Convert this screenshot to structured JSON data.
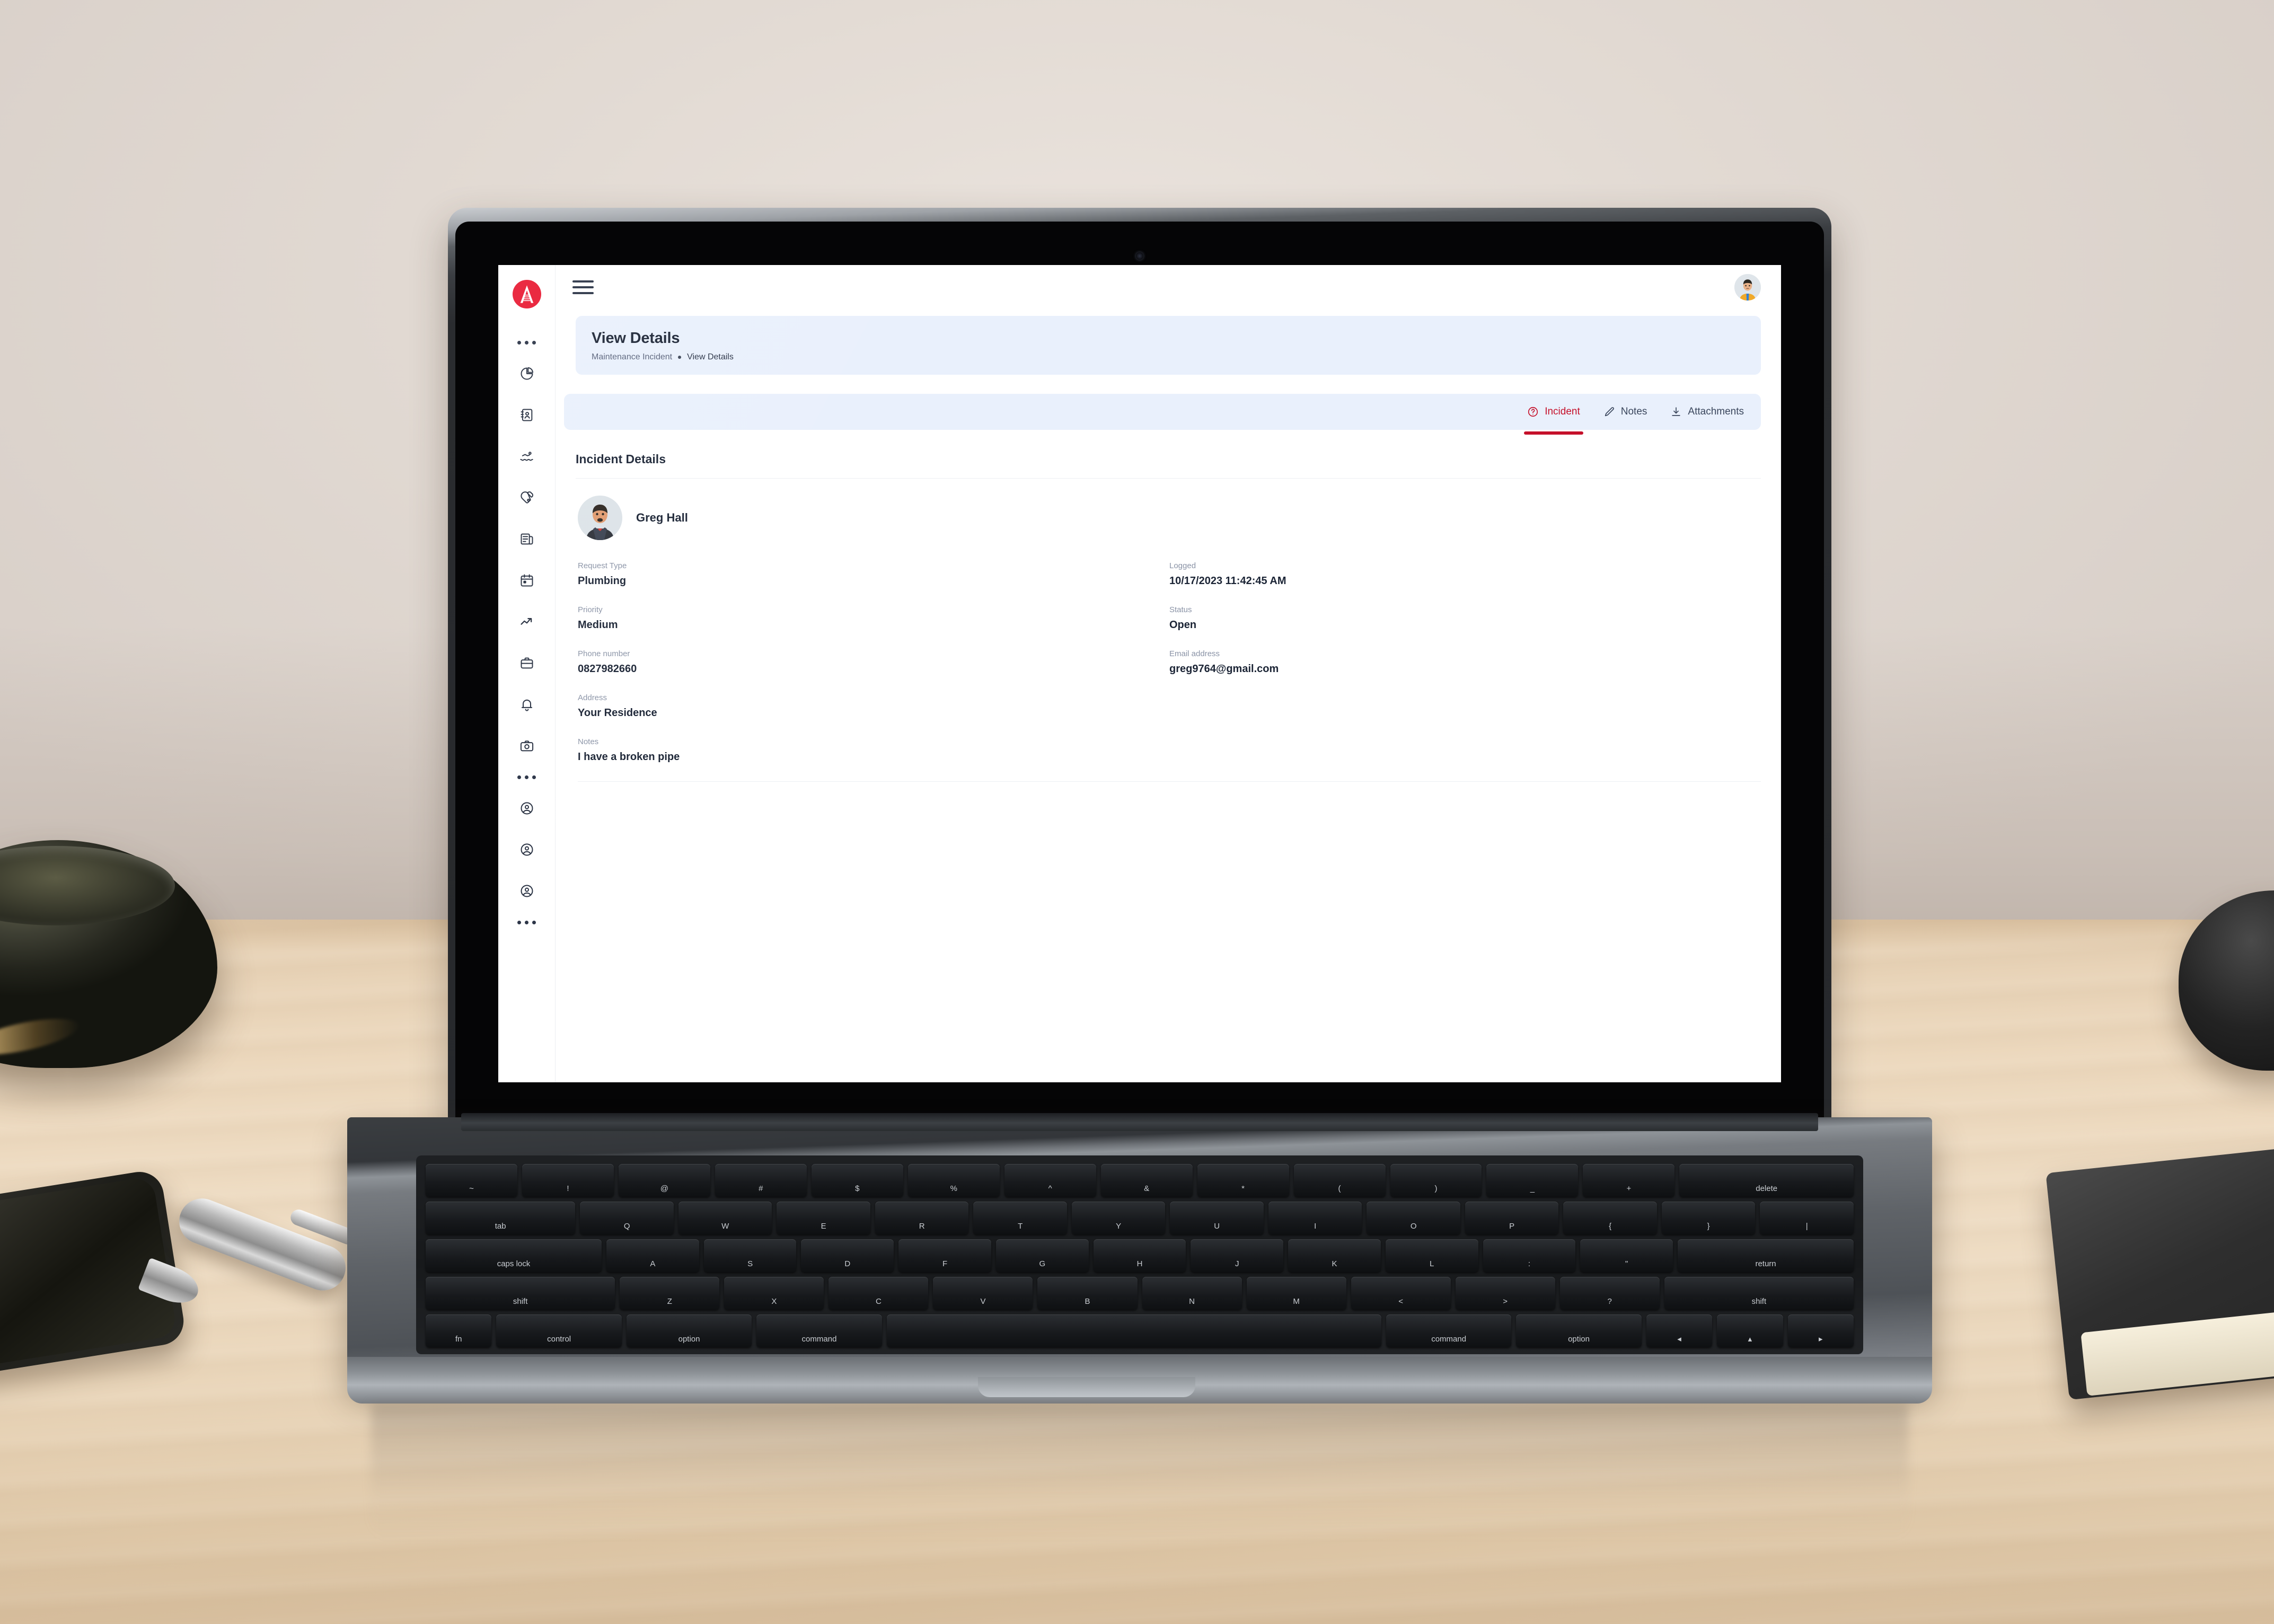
{
  "brand": {
    "name": "company-logo",
    "color": "#e8152e"
  },
  "sidebar": {
    "items": [
      {
        "icon": "ellipsis-divider-icon",
        "label": ""
      },
      {
        "icon": "pie-chart-icon",
        "label": ""
      },
      {
        "icon": "address-book-icon",
        "label": ""
      },
      {
        "icon": "swimmer-icon",
        "label": ""
      },
      {
        "icon": "table-tennis-icon",
        "label": ""
      },
      {
        "icon": "newspaper-icon",
        "label": ""
      },
      {
        "icon": "calendar-icon",
        "label": ""
      },
      {
        "icon": "trending-up-icon",
        "label": ""
      },
      {
        "icon": "briefcase-icon",
        "label": ""
      },
      {
        "icon": "bell-icon",
        "label": ""
      },
      {
        "icon": "camera-icon",
        "label": ""
      },
      {
        "icon": "ellipsis-divider-icon",
        "label": ""
      },
      {
        "icon": "user-circle-icon",
        "label": ""
      },
      {
        "icon": "user-circle-icon",
        "label": ""
      },
      {
        "icon": "user-circle-icon",
        "label": ""
      },
      {
        "icon": "ellipsis-divider-icon",
        "label": ""
      }
    ]
  },
  "topbar": {
    "menu_icon": "hamburger-menu-icon",
    "avatar": "user-avatar"
  },
  "header": {
    "title": "View Details",
    "breadcrumb_parent": "Maintenance Incident",
    "breadcrumb_current": "View Details",
    "bg": "#e9f0fc"
  },
  "tabs": [
    {
      "label": "Incident",
      "icon": "question-circle-icon",
      "active": true
    },
    {
      "label": "Notes",
      "icon": "pencil-icon",
      "active": false
    },
    {
      "label": "Attachments",
      "icon": "download-icon",
      "active": false
    }
  ],
  "accent_color": "#c5102a",
  "details": {
    "section_title": "Incident Details",
    "person_name": "Greg Hall",
    "rows": [
      {
        "left": {
          "label": "Request Type",
          "value": "Plumbing"
        },
        "right": {
          "label": "Logged",
          "value": "10/17/2023 11:42:45 AM"
        }
      },
      {
        "left": {
          "label": "Priority",
          "value": "Medium"
        },
        "right": {
          "label": "Status",
          "value": "Open"
        }
      },
      {
        "left": {
          "label": "Phone number",
          "value": "0827982660"
        },
        "right": {
          "label": "Email address",
          "value": "greg9764@gmail.com"
        }
      },
      {
        "left": {
          "label": "Address",
          "value": "Your Residence"
        },
        "right": {
          "label": "",
          "value": ""
        }
      },
      {
        "left": {
          "label": "Notes",
          "value": "I have a broken pipe"
        },
        "right": {
          "label": "",
          "value": ""
        }
      }
    ]
  },
  "keyboard": {
    "row1": [
      "~",
      "!",
      "@",
      "#",
      "$",
      "%",
      "^",
      "&",
      "*",
      "(",
      ")",
      "_",
      "+",
      "delete"
    ],
    "row2": [
      "tab",
      "Q",
      "W",
      "E",
      "R",
      "T",
      "Y",
      "U",
      "I",
      "O",
      "P",
      "{",
      "}",
      "|"
    ],
    "row3": [
      "caps lock",
      "A",
      "S",
      "D",
      "F",
      "G",
      "H",
      "J",
      "K",
      "L",
      ":",
      "\"",
      "return"
    ],
    "row4": [
      "shift",
      "Z",
      "X",
      "C",
      "V",
      "B",
      "N",
      "M",
      "<",
      ">",
      "?",
      "shift"
    ],
    "row5": [
      "fn",
      "control",
      "option",
      "command",
      "",
      "command",
      "option",
      "◂",
      "▴",
      "▸"
    ]
  }
}
